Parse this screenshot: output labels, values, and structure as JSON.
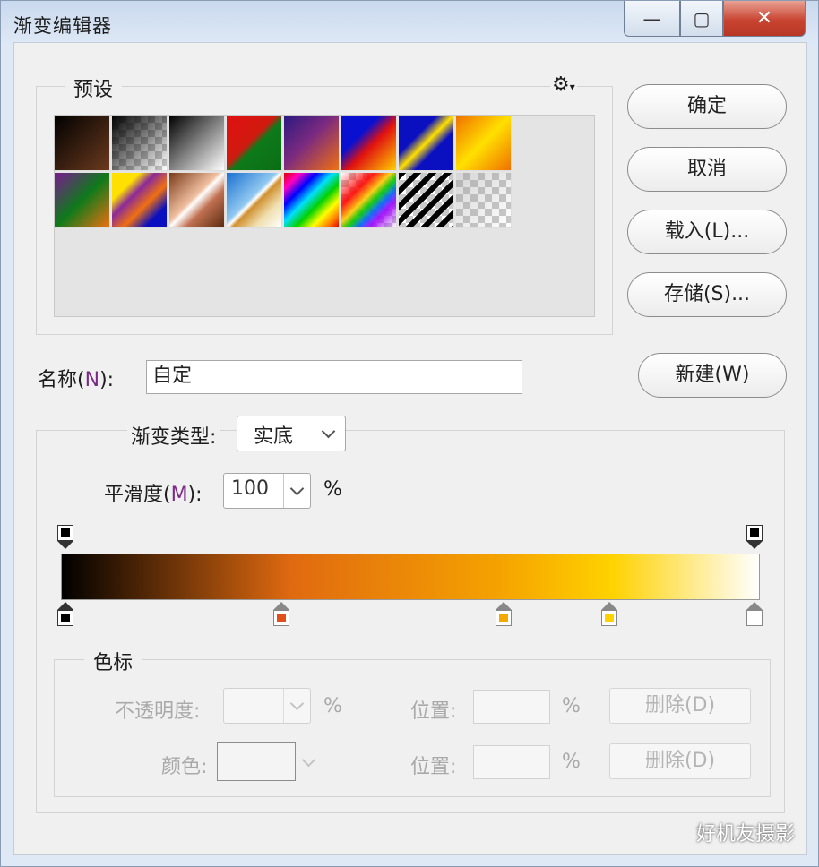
{
  "window": {
    "title": "渐变编辑器",
    "min_icon": "—",
    "max_icon": "▢",
    "close_icon": "✕"
  },
  "presets": {
    "label": "预设",
    "gear_icon": "⚙",
    "swatches_row1": [
      "black-to-brown",
      "transparent-black",
      "black-white",
      "red-green",
      "violet-orange",
      "blue-red-yellow",
      "blue-yellow-blue",
      "orange-yellow-orange"
    ],
    "swatches_row2": [
      "violet-green-orange",
      "yellow-violet-orange-blue",
      "copper",
      "chrome",
      "spectrum",
      "transparent-rainbow",
      "transparent-stripes",
      "transparent"
    ]
  },
  "buttons": {
    "ok": "确定",
    "cancel": "取消",
    "load": "载入(L)...",
    "save": "存储(S)...",
    "new": "新建(W)"
  },
  "name_field": {
    "label_main": "名称(",
    "label_key": "N",
    "label_end": "):",
    "value": "自定"
  },
  "gradient_type": {
    "label": "渐变类型:",
    "value": "实底"
  },
  "smoothness": {
    "label_main": "平滑度(",
    "label_key": "M",
    "label_end": "):",
    "value": "100",
    "unit": "%"
  },
  "stops_group": {
    "label": "色标",
    "opacity_label": "不透明度:",
    "opacity_unit": "%",
    "color_label": "颜色:",
    "position_label": "位置:",
    "position_unit": "%",
    "delete_label": "删除(D)"
  },
  "colors": {
    "accent": "#7b2a88",
    "stop_black": "#000000",
    "stop_orange": "#e0501a",
    "stop_amber": "#f5a800",
    "stop_yellow": "#ffd200",
    "stop_white": "#ffffff"
  },
  "watermark": "好机友摄影"
}
